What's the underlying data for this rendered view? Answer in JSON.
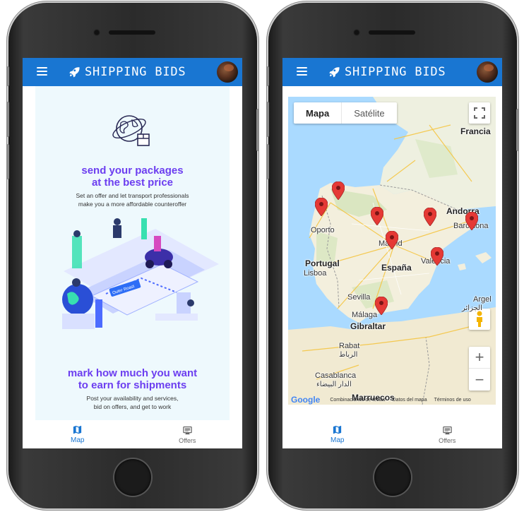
{
  "app": {
    "title": "SHIPPING BIDS"
  },
  "colors": {
    "primary": "#1976d2",
    "headline": "#6c3ef0",
    "panel": "#eef9fd",
    "pin": "#e53935",
    "land": "#f4f0e1",
    "water": "#aadaff"
  },
  "nav": {
    "map": "Map",
    "offers": "Offers"
  },
  "left": {
    "headline1": [
      "send your packages",
      "at the best price"
    ],
    "sub1": [
      "Set an offer and let transport professionals",
      "make you a more affordable counteroffer"
    ],
    "headline2": [
      "mark how much you want",
      "to earn for shipments"
    ],
    "sub2": [
      "Post your availability and services,",
      "bid on offers, and get to work"
    ],
    "illustration_tag": "Outer Roast"
  },
  "map": {
    "type_options": [
      "Mapa",
      "Satélite"
    ],
    "selected_type": "Mapa",
    "zoom_in": "+",
    "zoom_out": "−",
    "labels": {
      "francia": "Francia",
      "andorra": "Andorra",
      "barcelona": "Barcelona",
      "oporto": "Oporto",
      "madrid": "Madrid",
      "portugal": "Portugal",
      "espana": "España",
      "valencia": "Valencia",
      "lisboa": "Lisboa",
      "sevilla": "Sevilla",
      "malaga": "Málaga",
      "gibraltar": "Gibraltar",
      "argel": "Argel",
      "argel_ar": "الجزائر",
      "rabat": "Rabat",
      "rabat_ar": "الرباط",
      "casablanca": "Casablanca",
      "casablanca_ar": "الدار البيضاء",
      "marruecos": "Marruecos"
    },
    "attribution": {
      "logo": "Google",
      "shortcuts": "Combinaciones de teclas",
      "data": "Datos del mapa",
      "terms": "Términos de uso"
    },
    "marker_count": 9
  },
  "icons": {
    "menu": "menu-icon",
    "rocket": "rocket-icon",
    "map": "map-icon",
    "offers": "offers-icon",
    "fullscreen": "fullscreen-icon",
    "pegman": "pegman-icon",
    "marker": "map-marker-icon"
  }
}
